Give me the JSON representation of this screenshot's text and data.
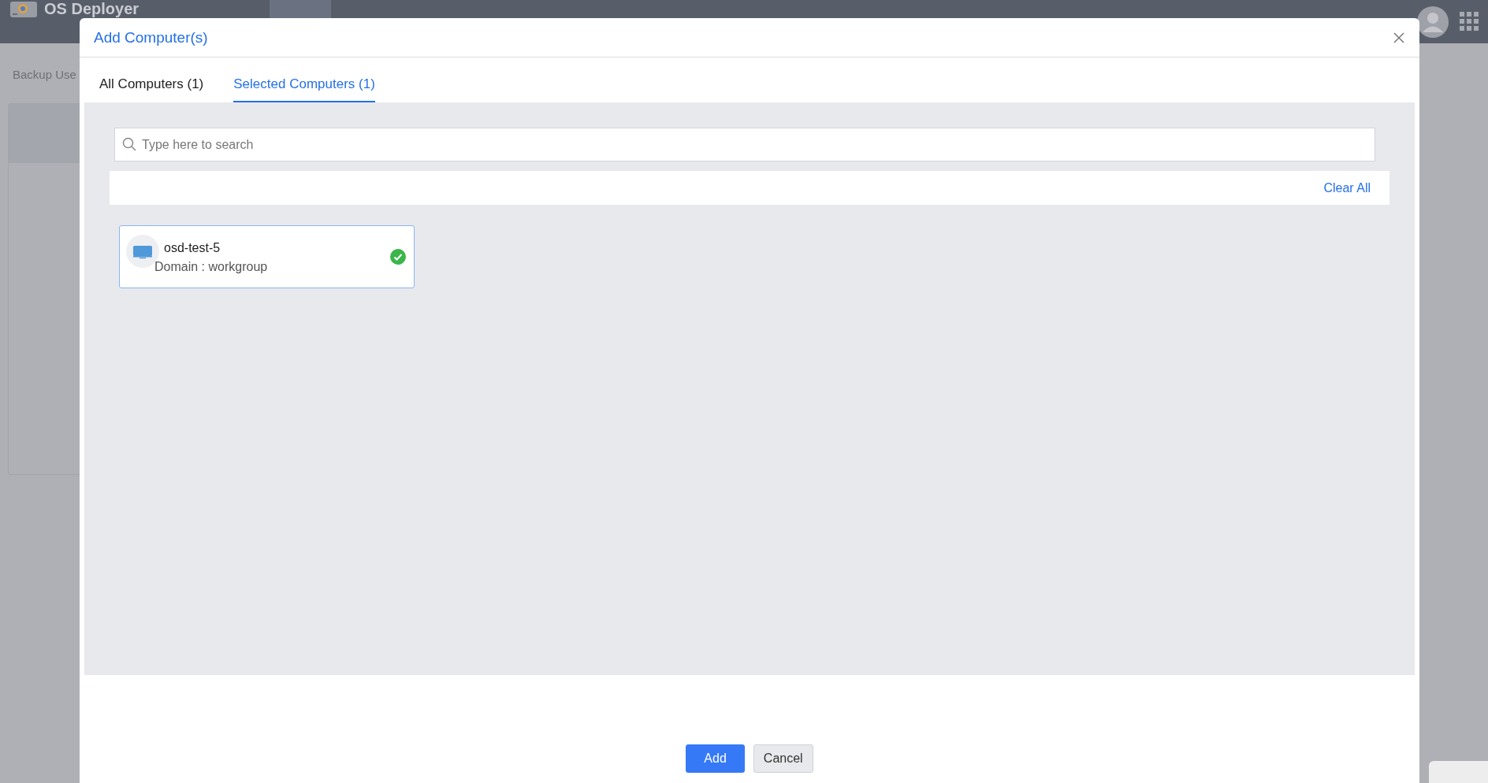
{
  "app": {
    "name": "OS Deployer"
  },
  "background": {
    "breadcrumb": "Backup Use"
  },
  "dialog": {
    "title": "Add Computer(s)",
    "tabs": [
      {
        "label": "All Computers (1)",
        "selected": false
      },
      {
        "label": "Selected Computers (1)",
        "selected": true
      }
    ],
    "search": {
      "placeholder": "Type here to search"
    },
    "clear_all": "Clear All",
    "computers": [
      {
        "name": "osd-test-5",
        "domain": "Domain : workgroup",
        "selected": true
      }
    ],
    "buttons": [
      {
        "label": "Add",
        "kind": "primary"
      },
      {
        "label": "Cancel",
        "kind": "secondary"
      }
    ]
  }
}
